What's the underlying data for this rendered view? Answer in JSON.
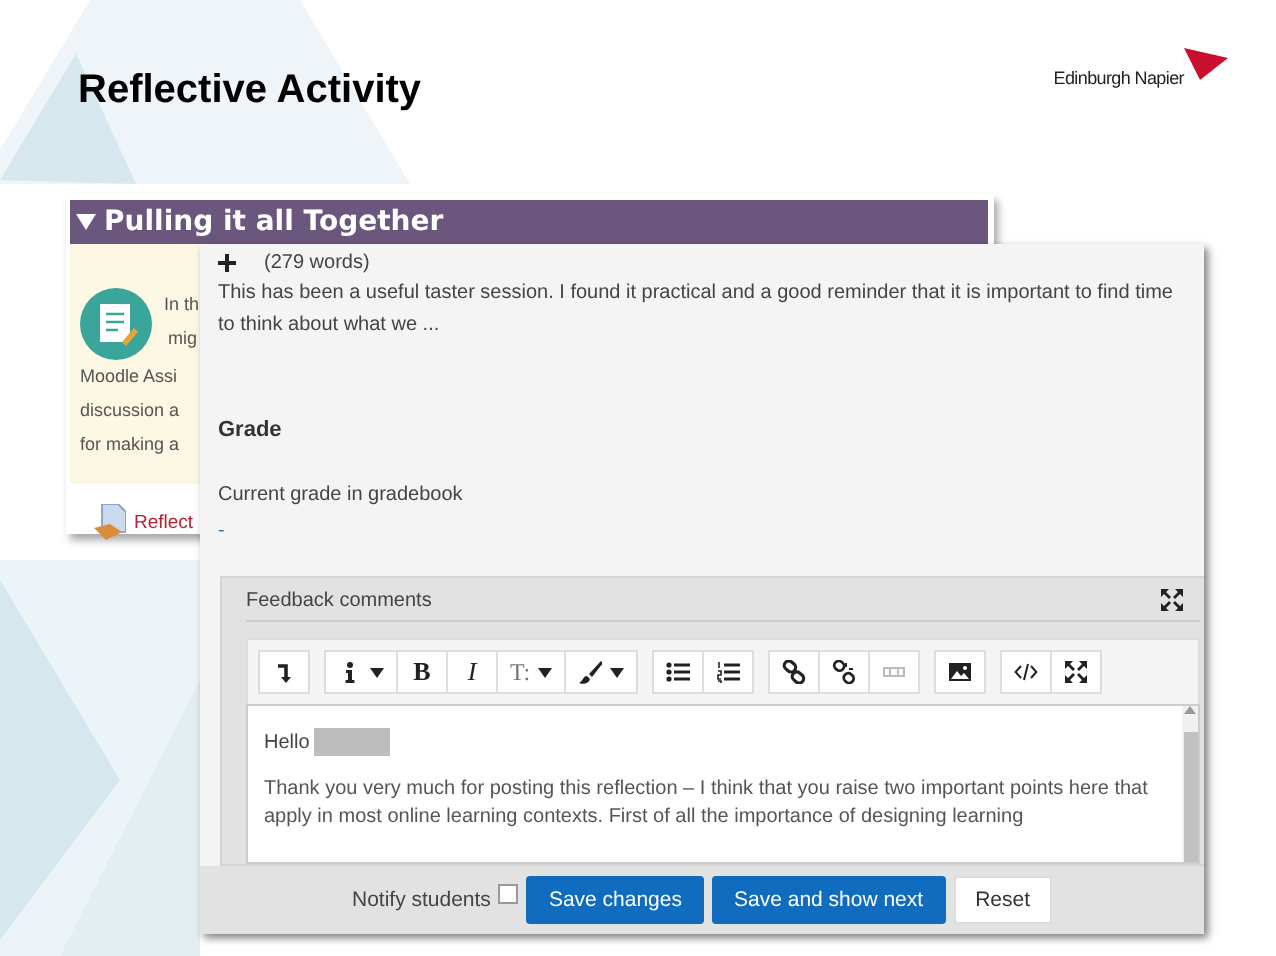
{
  "slide": {
    "title": "Reflective Activity",
    "logo_text": "Edinburgh Napier"
  },
  "section": {
    "title": "Pulling it all Together",
    "expanded": true,
    "intro_lines": [
      "In th",
      "mig"
    ],
    "body_lines": [
      "Moodle Assi",
      "discussion a",
      "for making a"
    ],
    "link": "Reflect"
  },
  "submission": {
    "expanded": false,
    "word_count": "(279 words)",
    "excerpt": "This has been a useful taster session. I found it practical and a good reminder that it is important to find time to think about what we ...",
    "grade_heading": "Grade",
    "current_grade_label": "Current grade in gradebook",
    "current_grade_value": "-"
  },
  "feedback": {
    "label": "Feedback comments",
    "toolbar": [
      [
        {
          "kind": "undo",
          "dropdown": false
        }
      ],
      [
        {
          "kind": "info",
          "dropdown": true
        },
        {
          "kind": "bold",
          "label": "B",
          "dropdown": false
        },
        {
          "kind": "italic",
          "label": "I",
          "dropdown": false
        },
        {
          "kind": "fontsize",
          "label": "T:",
          "dropdown": true
        },
        {
          "kind": "brush",
          "dropdown": true
        }
      ],
      [
        {
          "kind": "bullets",
          "dropdown": false
        },
        {
          "kind": "numbers",
          "dropdown": false
        }
      ],
      [
        {
          "kind": "link",
          "dropdown": false
        },
        {
          "kind": "unlink",
          "dropdown": false
        },
        {
          "kind": "nolink",
          "dropdown": false
        }
      ],
      [
        {
          "kind": "image",
          "dropdown": false
        }
      ],
      [
        {
          "kind": "code",
          "dropdown": false
        },
        {
          "kind": "fullscreen",
          "dropdown": false
        }
      ]
    ],
    "greeting": "Hello",
    "message": "Thank you very much for posting this reflection – I think that you raise two important points here that apply in most online learning contexts.  First of all the importance of designing learning"
  },
  "footer": {
    "notify_label": "Notify students",
    "notify_checked": false,
    "buttons": [
      {
        "label": "Save changes",
        "kind": "primary"
      },
      {
        "label": "Save and show next",
        "kind": "primary"
      },
      {
        "label": "Reset",
        "kind": "secondary"
      }
    ]
  }
}
